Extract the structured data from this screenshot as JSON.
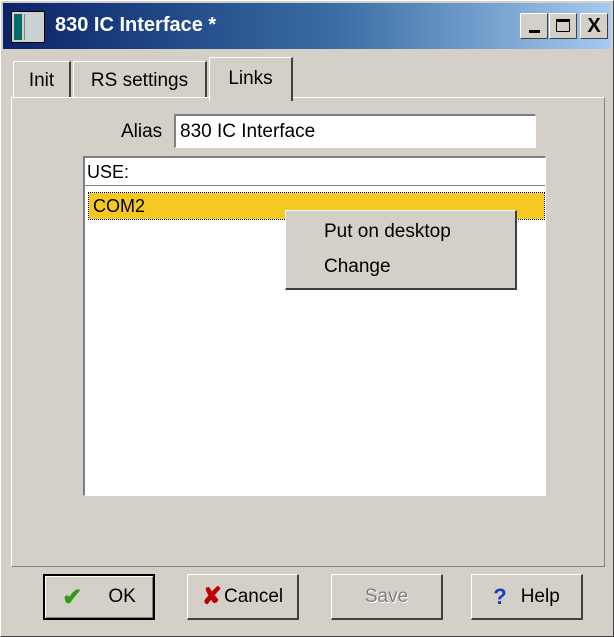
{
  "window": {
    "title": "830 IC Interface *",
    "controls": {
      "minimize_icon": "minimize-icon",
      "maximize_icon": "maximize-icon",
      "close_glyph": "X"
    }
  },
  "tabs": [
    {
      "label": "Init",
      "active": false
    },
    {
      "label": "RS settings",
      "active": false
    },
    {
      "label": "Links",
      "active": true
    }
  ],
  "alias": {
    "label": "Alias",
    "value": "830 IC Interface"
  },
  "use_list": {
    "header": "USE:",
    "items": [
      {
        "label": "COM2",
        "selected": true
      }
    ]
  },
  "context_menu": {
    "items": [
      {
        "label": "Put on desktop"
      },
      {
        "label": "Change"
      }
    ]
  },
  "buttons": {
    "ok": {
      "label": "OK",
      "icon": "checkmark-icon"
    },
    "cancel": {
      "label": "Cancel",
      "icon": "x-cancel-icon"
    },
    "save": {
      "label": "Save",
      "enabled": false
    },
    "help": {
      "label": "Help",
      "icon": "question-icon"
    }
  },
  "colors": {
    "selection": "#f5c822",
    "titlebar_start": "#0a246a",
    "titlebar_end": "#a6caf0"
  }
}
